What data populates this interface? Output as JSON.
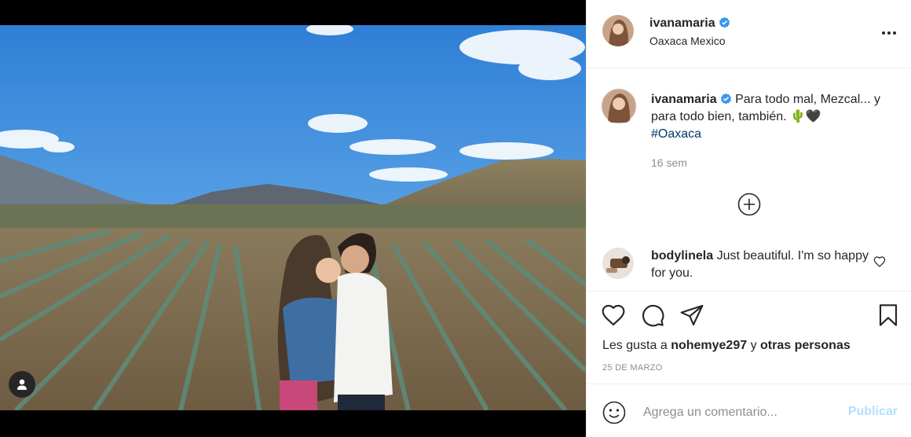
{
  "post": {
    "username": "ivanamaria",
    "location": "Oaxaca Mexico",
    "caption_text": "Para todo mal, Mezcal... y para todo bien, también. 🌵🖤",
    "caption_hashtag": "#Oaxaca",
    "caption_time": "16 sem",
    "comment": {
      "username": "bodylinela",
      "text": "Just beautiful. I'm so happy for you."
    },
    "likes_prefix": "Les gusta a",
    "likes_user": "nohemye297",
    "likes_join": "y",
    "likes_others": "otras personas",
    "date": "25 DE MARZO",
    "comment_placeholder": "Agrega un comentario...",
    "publish_label": "Publicar"
  },
  "icons": {
    "verified": "verified-badge-icon",
    "more": "more-options-icon",
    "load_more": "plus-circle-icon",
    "like": "heart-icon",
    "comment": "comment-icon",
    "share": "send-icon",
    "save": "bookmark-icon",
    "emoji": "emoji-icon",
    "tag": "user-tag-icon"
  },
  "colors": {
    "verified": "#3897f0",
    "link": "#00376b",
    "publish_disabled": "#b2dffc",
    "secondary_text": "#8e8e8e"
  }
}
